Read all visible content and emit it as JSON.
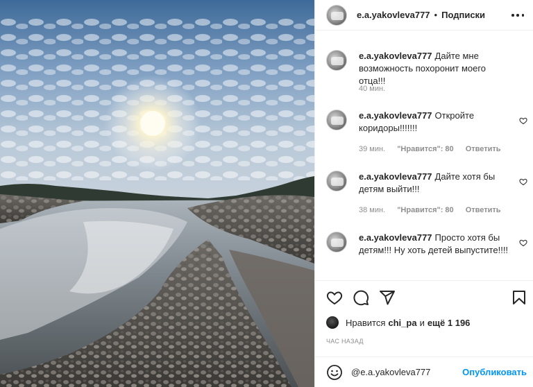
{
  "header": {
    "username": "e.a.yakovleva777",
    "separator": "•",
    "follow_label": "Подписки"
  },
  "comments": [
    {
      "username": "e.a.yakovleva777",
      "text": "Дайте мне возможность похоронит моего отца!!!",
      "time": "40 мин.",
      "likes": "",
      "reply": ""
    },
    {
      "username": "e.a.yakovleva777",
      "text": "Откройте коридоры!!!!!!!",
      "time": "39 мин.",
      "likes": "\"Нравится\": 80",
      "reply": "Ответить"
    },
    {
      "username": "e.a.yakovleva777",
      "text": "Дайте хотя бы детям выйти!!!",
      "time": "38 мин.",
      "likes": "\"Нравится\": 80",
      "reply": "Ответить"
    },
    {
      "username": "e.a.yakovleva777",
      "text": "Просто хотя бы детям!!! Ну хоть детей выпустите!!!!",
      "time": "",
      "likes": "",
      "reply": ""
    }
  ],
  "likes_row": {
    "prefix": "Нравится",
    "user": "chi_pa",
    "conj": "и",
    "others": "ещё 1 196"
  },
  "time_ago": "час назад",
  "comment_box": {
    "value": "@e.a.yakovleva777",
    "publish_label": "Опубликовать"
  },
  "icons": {
    "like": "heart-icon",
    "comment": "comment-icon",
    "share": "send-icon",
    "save": "bookmark-icon",
    "emoji": "emoji-icon",
    "more": "more-icon"
  },
  "colors": {
    "accent": "#0095f6",
    "text": "#262626",
    "secondary": "#8e8e8e",
    "border": "#efefef"
  }
}
